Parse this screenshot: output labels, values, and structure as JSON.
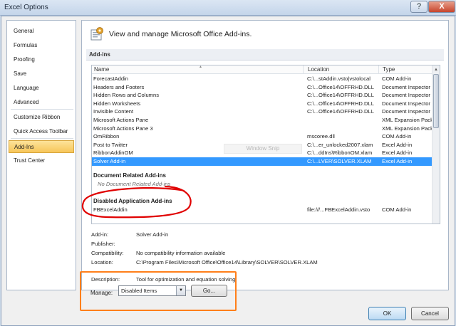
{
  "window": {
    "title": "Excel Options",
    "help_glyph": "?",
    "close_glyph": "X"
  },
  "sidebar": {
    "items": [
      {
        "label": "General"
      },
      {
        "label": "Formulas"
      },
      {
        "label": "Proofing"
      },
      {
        "label": "Save"
      },
      {
        "label": "Language"
      },
      {
        "label": "Advanced"
      },
      {
        "label": "Customize Ribbon"
      },
      {
        "label": "Quick Access Toolbar"
      },
      {
        "label": "Add-Ins"
      },
      {
        "label": "Trust Center"
      }
    ],
    "selected": "Add-Ins"
  },
  "main": {
    "header": "View and manage Microsoft Office Add-ins.",
    "section": "Add-ins",
    "columns": {
      "name": "Name",
      "location": "Location",
      "type": "Type",
      "sort_arrow": "▲"
    },
    "rows": [
      {
        "name": "ForecastAddin",
        "location": "C:\\...stAddin.vsto|vstolocal",
        "type": "COM Add-in"
      },
      {
        "name": "Headers and Footers",
        "location": "C:\\...Office14\\OFFRHD.DLL",
        "type": "Document Inspector"
      },
      {
        "name": "Hidden Rows and Columns",
        "location": "C:\\...Office14\\OFFRHD.DLL",
        "type": "Document Inspector"
      },
      {
        "name": "Hidden Worksheets",
        "location": "C:\\...Office14\\OFFRHD.DLL",
        "type": "Document Inspector"
      },
      {
        "name": "Invisible Content",
        "location": "C:\\...Office14\\OFFRHD.DLL",
        "type": "Document Inspector"
      },
      {
        "name": "Microsoft Actions Pane",
        "location": "",
        "type": "XML Expansion Pack"
      },
      {
        "name": "Microsoft Actions Pane 3",
        "location": "",
        "type": "XML Expansion Pack"
      },
      {
        "name": "OmRibbon",
        "location": "mscoree.dll",
        "type": "COM Add-in"
      },
      {
        "name": "Post to Twitter",
        "location": "C:\\...er_unlocked2007.xlam",
        "type": "Excel Add-in"
      },
      {
        "name": "RibbonAddinOM",
        "location": "C:\\...ddIns\\RibbonOM.xlam",
        "type": "Excel Add-in"
      },
      {
        "name": "Solver Add-in",
        "location": "C:\\...LVER\\SOLVER.XLAM",
        "type": "Excel Add-in"
      }
    ],
    "selected_row": 10,
    "doc_related": {
      "title": "Document Related Add-ins",
      "none": "No Document Related Add-ins"
    },
    "disabled": {
      "title": "Disabled Application Add-ins",
      "row": {
        "name": "FBExcelAddin",
        "location": "file:///...FBExcelAddin.vsto",
        "type": "COM Add-in"
      }
    },
    "overlay_text": "Window Snip",
    "details": {
      "addin": {
        "label": "Add-in:",
        "value": "Solver Add-in"
      },
      "publisher": {
        "label": "Publisher:",
        "value": ""
      },
      "compatibility": {
        "label": "Compatibility:",
        "value": "No compatibility information available"
      },
      "location": {
        "label": "Location:",
        "value": "C:\\Program Files\\Microsoft Office\\Office14\\Library\\SOLVER\\SOLVER.XLAM"
      },
      "description": {
        "label": "Description:",
        "value": "Tool for optimization and equation solving"
      }
    },
    "manage": {
      "label": "Manage:",
      "value": "Disabled Items",
      "go": "Go..."
    }
  },
  "footer": {
    "ok": "OK",
    "cancel": "Cancel"
  },
  "colors": {
    "selection": "#3399ff",
    "nav_selected": "#f7c65a",
    "annotation_orange": "#ff7f1a",
    "annotation_red": "#e00000"
  }
}
